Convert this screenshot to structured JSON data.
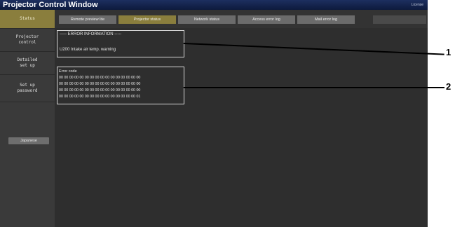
{
  "window": {
    "title": "Projector Control Window",
    "license_link": "License"
  },
  "sidebar": {
    "items": [
      {
        "label": "Status",
        "active": true
      },
      {
        "label": "Projector\ncontrol",
        "active": false
      },
      {
        "label": "Detailed\nset up",
        "active": false
      },
      {
        "label": "Set up\npassword",
        "active": false
      }
    ],
    "language_button": "Japanese"
  },
  "tabs": [
    {
      "label": "Remote preview lite",
      "active": false
    },
    {
      "label": "Projector status",
      "active": true
    },
    {
      "label": "Network status",
      "active": false
    },
    {
      "label": "Access error log",
      "active": false
    },
    {
      "label": "Mail error log",
      "active": false
    }
  ],
  "error_information": {
    "header": "----- ERROR INFORMATION -----",
    "message": "U200 Intake air temp. warning"
  },
  "error_code": {
    "header": "Error code",
    "lines": [
      "00 00 00 00 00 00 00 00 00 00 00 00 00 00 00 00",
      "00 00 00 00 00 00 00 00 00 00 00 00 00 00 00 00",
      "00 00 00 00 00 00 00 00 00 00 00 00 00 00 00 00",
      "00 00 00 00 00 00 00 00 00 00 00 00 00 00 00 01"
    ]
  },
  "callouts": [
    "1",
    "2"
  ],
  "colors": {
    "accent": "#8a7e3d",
    "titlebar": "#0d1a3d",
    "background": "#2b2b2b"
  }
}
